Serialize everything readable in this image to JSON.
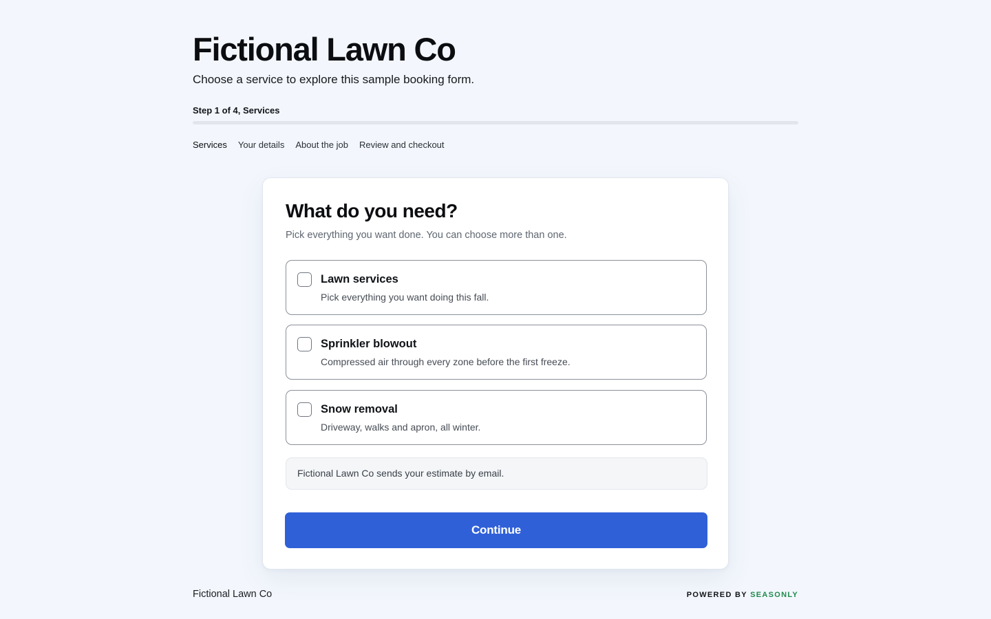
{
  "header": {
    "title": "Fictional Lawn Co",
    "subtitle": "Choose a service to explore this sample booking form."
  },
  "progress": {
    "label": "Step 1 of 4, Services",
    "current_step": 1,
    "total_steps": 4,
    "fill_fraction": 0.0,
    "steps": [
      {
        "label": "Services",
        "active": true
      },
      {
        "label": "Your details",
        "active": false
      },
      {
        "label": "About the job",
        "active": false
      },
      {
        "label": "Review and checkout",
        "active": false
      }
    ]
  },
  "card": {
    "title": "What do you need?",
    "subtitle": "Pick everything you want done. You can choose more than one.",
    "options": [
      {
        "title": "Lawn services",
        "description": "Pick everything you want doing this fall.",
        "checked": false
      },
      {
        "title": "Sprinkler blowout",
        "description": "Compressed air through every zone before the first freeze.",
        "checked": false
      },
      {
        "title": "Snow removal",
        "description": "Driveway, walks and apron, all winter.",
        "checked": false
      }
    ],
    "info_text": "Fictional Lawn Co sends your estimate by email.",
    "continue_label": "Continue"
  },
  "footer": {
    "brand": "Fictional Lawn Co",
    "powered_prefix": "POWERED BY",
    "powered_brand": "SEASONLY"
  },
  "colors": {
    "background": "#f3f7fd",
    "accent": "#3060d8",
    "powered_brand": "#1f8a4c"
  }
}
